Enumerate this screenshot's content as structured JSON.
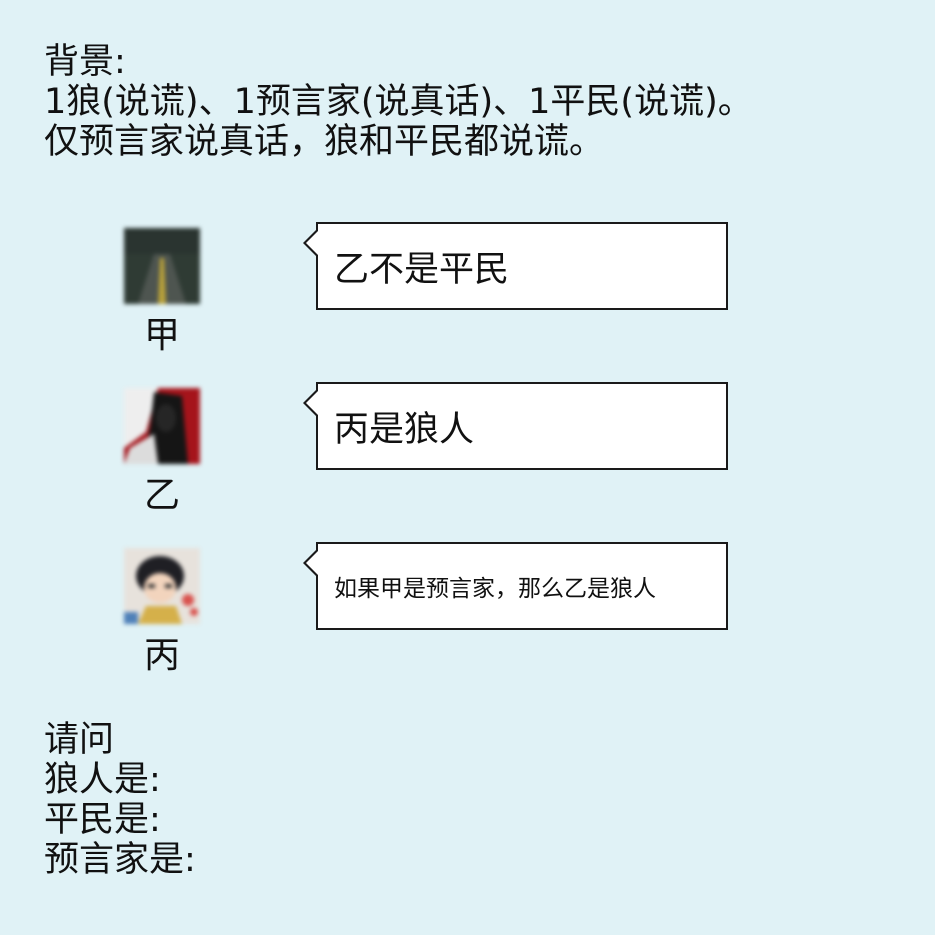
{
  "background": {
    "heading": "背景:",
    "line1": "1狼(说谎)、1预言家(说真话)、1平民(说谎)。",
    "line2": "仅预言家说真话，狼和平民都说谎。"
  },
  "speakers": [
    {
      "name": "甲",
      "statement": "乙不是平民",
      "avatar": "road-photo-avatar"
    },
    {
      "name": "乙",
      "statement": "丙是狼人",
      "avatar": "dark-figure-avatar"
    },
    {
      "name": "丙",
      "statement": "如果甲是预言家，那么乙是狼人",
      "avatar": "anime-character-avatar"
    }
  ],
  "question": {
    "heading": "请问",
    "wolf": "狼人是:",
    "villager": "平民是:",
    "seer": "预言家是:"
  },
  "colors": {
    "page_background": "#e0f2f6",
    "bubble_background": "#ffffff",
    "bubble_border": "#1a1a1a",
    "text": "#111111"
  }
}
